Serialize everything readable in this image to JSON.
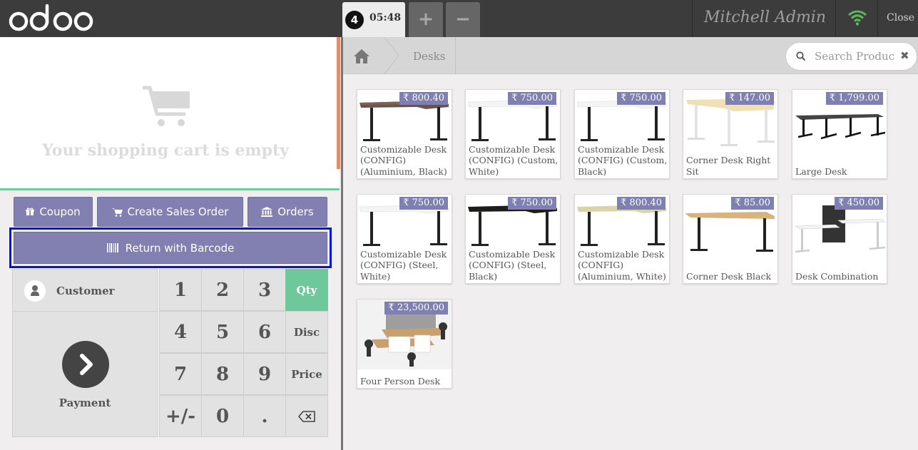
{
  "header": {
    "logo_text": "odoo",
    "order": {
      "number": "4",
      "time": "05:48"
    },
    "add_order_label": "+",
    "remove_order_label": "−",
    "user": "Mitchell Admin",
    "wifi_icon": "wifi-icon",
    "close_label": "Close",
    "colors": {
      "bar": "#3c3c3c",
      "wifi": "#5cb85c"
    }
  },
  "cart": {
    "empty_text": "Your shopping cart is empty"
  },
  "control_buttons": {
    "coupon": "Coupon",
    "create_sales_order": "Create Sales Order",
    "orders": "Orders",
    "return_with_barcode": "Return with Barcode"
  },
  "actionpad": {
    "customer": "Customer",
    "payment": "Payment"
  },
  "numpad": {
    "keys": [
      "1",
      "2",
      "3",
      "4",
      "5",
      "6",
      "7",
      "8",
      "9",
      "+/-",
      "0",
      "."
    ],
    "modes": {
      "qty": "Qty",
      "disc": "Disc",
      "price": "Price"
    },
    "active_mode": "Qty",
    "backspace_icon": "backspace-icon"
  },
  "products_screen": {
    "breadcrumb": "Desks",
    "search_placeholder": "Search Products",
    "products": [
      {
        "name": "Customizable Desk (CONFIG) (Aluminium, Black)",
        "price": "₹ 800.40"
      },
      {
        "name": "Customizable Desk (CONFIG) (Custom, White)",
        "price": "₹ 750.00"
      },
      {
        "name": "Customizable Desk (CONFIG) (Custom, Black)",
        "price": "₹ 750.00"
      },
      {
        "name": "Corner Desk Right Sit",
        "price": "₹ 147.00"
      },
      {
        "name": "Large Desk",
        "price": "₹ 1,799.00"
      },
      {
        "name": "Customizable Desk (CONFIG) (Steel, White)",
        "price": "₹ 750.00"
      },
      {
        "name": "Customizable Desk (CONFIG) (Steel, Black)",
        "price": "₹ 750.00"
      },
      {
        "name": "Customizable Desk (CONFIG) (Aluminium, White)",
        "price": "₹ 800.40"
      },
      {
        "name": "Corner Desk Black",
        "price": "₹ 85.00"
      },
      {
        "name": "Desk Combination",
        "price": "₹ 450.00"
      },
      {
        "name": "Four Person Desk",
        "price": "₹ 23,500.00"
      }
    ]
  }
}
